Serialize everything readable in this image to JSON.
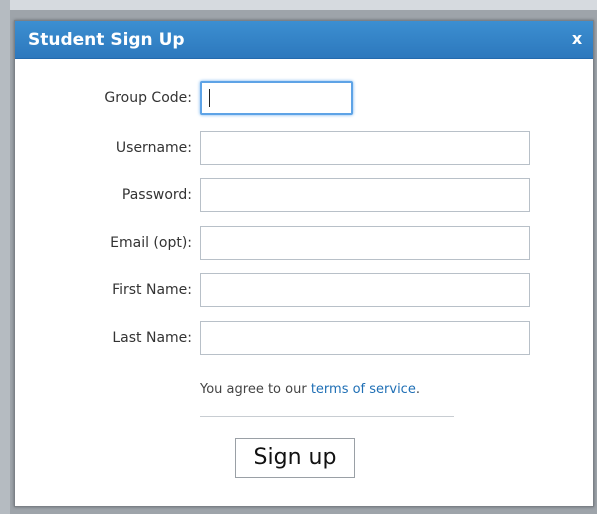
{
  "dialog": {
    "title": "Student Sign Up",
    "close_label": "x"
  },
  "form": {
    "fields": [
      {
        "label": "Group Code:",
        "value": "",
        "focused": true
      },
      {
        "label": "Username:",
        "value": ""
      },
      {
        "label": "Password:",
        "value": ""
      },
      {
        "label": "Email (opt):",
        "value": ""
      },
      {
        "label": "First Name:",
        "value": ""
      },
      {
        "label": "Last Name:",
        "value": ""
      }
    ],
    "agreement_prefix": "You agree to our ",
    "terms_link": "terms of service",
    "agreement_suffix": ".",
    "submit_label": "Sign up"
  },
  "colors": {
    "titlebar": "#2d78bd",
    "focus_ring": "#5ea3e6",
    "link": "#1f6fb5"
  }
}
